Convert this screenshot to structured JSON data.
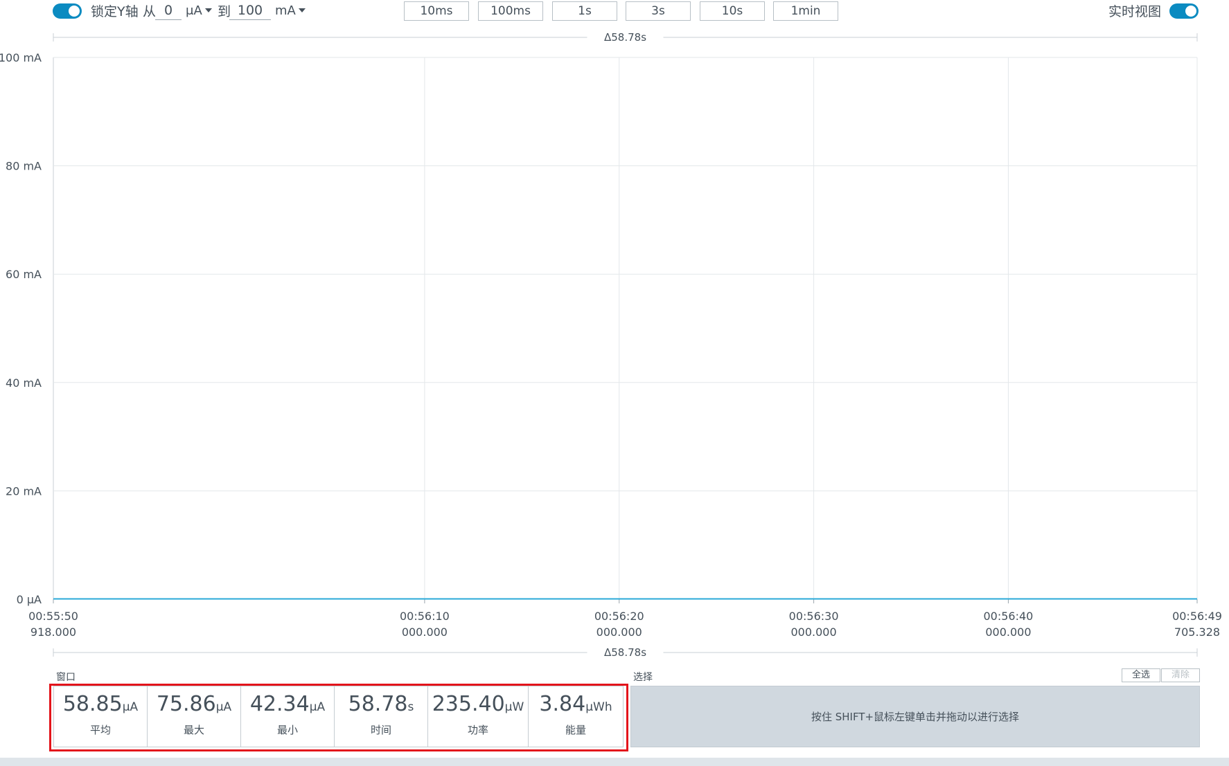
{
  "toolbar": {
    "lock_y_label": "锁定Y轴",
    "from_label": "从",
    "from_value": "0",
    "from_unit": "μA",
    "to_label": "到",
    "to_value": "100",
    "to_unit": "mA",
    "window_buttons": [
      "10ms",
      "100ms",
      "1s",
      "3s",
      "10s",
      "1min"
    ],
    "live_view_label": "实时视图",
    "lock_y_enabled": true,
    "live_view_enabled": true
  },
  "colors": {
    "accent": "#0b8bc1",
    "trace": "#2aa9d8",
    "grid": "#e3e7ea",
    "highlight": "#e3141b",
    "selection_bg": "#d0d8df"
  },
  "chart_data": {
    "type": "line",
    "delta_label": "Δ58.78s",
    "y_tick_labels": [
      "100 mA",
      "80 mA",
      "60 mA",
      "40 mA",
      "20 mA",
      "0 μA"
    ],
    "y_tick_values_mA": [
      100,
      80,
      60,
      40,
      20,
      0
    ],
    "ylim_mA": [
      0,
      100
    ],
    "x_ticks": [
      {
        "t": 0,
        "line1": "00:55:50",
        "line2": "918.000"
      },
      {
        "t": 19.082,
        "line1": "00:56:10",
        "line2": "000.000"
      },
      {
        "t": 29.082,
        "line1": "00:56:20",
        "line2": "000.000"
      },
      {
        "t": 39.082,
        "line1": "00:56:30",
        "line2": "000.000"
      },
      {
        "t": 49.082,
        "line1": "00:56:40",
        "line2": "000.000"
      },
      {
        "t": 58.787,
        "line1": "00:56:49",
        "line2": "705.328"
      }
    ],
    "xlim_s": [
      0,
      58.787
    ],
    "series": [
      {
        "x_s": [
          0,
          58.787
        ],
        "y_mA": [
          0.059,
          0.059
        ]
      }
    ],
    "grid": true
  },
  "stats": {
    "window_label": "窗口",
    "items": [
      {
        "value": "58.85",
        "unit": "μA",
        "label": "平均"
      },
      {
        "value": "75.86",
        "unit": "μA",
        "label": "最大"
      },
      {
        "value": "42.34",
        "unit": "μA",
        "label": "最小"
      },
      {
        "value": "58.78",
        "unit": "s",
        "label": "时间"
      },
      {
        "value": "235.40",
        "unit": "μW",
        "label": "功率"
      },
      {
        "value": "3.84",
        "unit": "μWh",
        "label": "能量"
      }
    ]
  },
  "selection": {
    "label": "选择",
    "select_all": "全选",
    "clear": "清除",
    "hint": "按住 SHIFT+鼠标左键单击并拖动以进行选择"
  }
}
